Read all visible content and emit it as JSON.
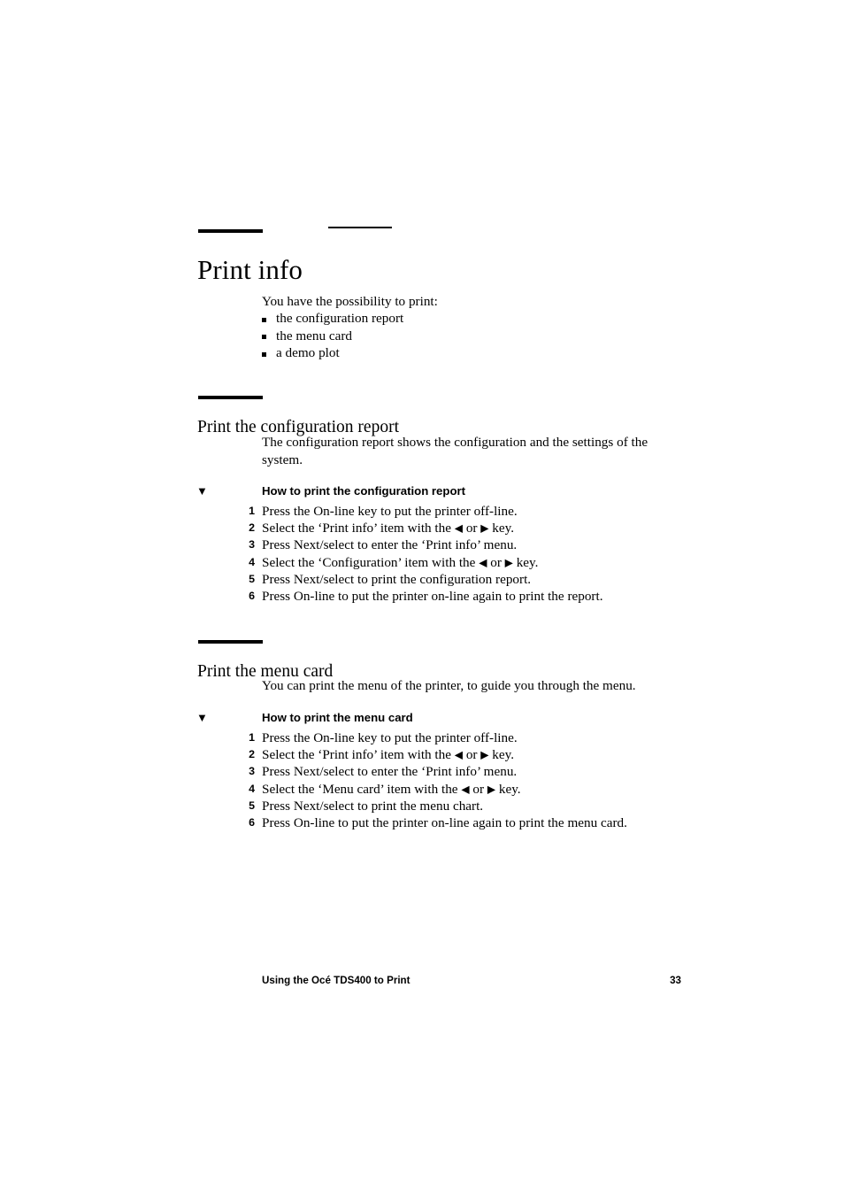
{
  "page": {
    "title": "Print info",
    "footer_text": "Using the Océ TDS400 to Print",
    "page_number": "33"
  },
  "intro": {
    "lead": "You have the possibility to print:",
    "bullets": [
      "the configuration report",
      "the menu card",
      "a demo plot"
    ]
  },
  "sections": [
    {
      "heading": "Print the configuration report",
      "body": "The configuration report shows the configuration and the settings of the system.",
      "procedure_marker": "▼",
      "procedure_title": "How to print the configuration report",
      "steps": [
        {
          "num": "1",
          "pre": "Press the On-line key to put the printer off-line.",
          "left_arrow": "",
          "mid": "",
          "right_arrow": "",
          "post": ""
        },
        {
          "num": "2",
          "pre": "Select the ‘Print info’ item with the ",
          "left_arrow": "◀",
          "mid": "  or  ",
          "right_arrow": "▶",
          "post": " key."
        },
        {
          "num": "3",
          "pre": "Press Next/select to enter the ‘Print info’ menu.",
          "left_arrow": "",
          "mid": "",
          "right_arrow": "",
          "post": ""
        },
        {
          "num": "4",
          "pre": "Select the ‘Configuration’ item with the ",
          "left_arrow": "◀",
          "mid": "  or  ",
          "right_arrow": "▶",
          "post": " key."
        },
        {
          "num": "5",
          "pre": "Press Next/select to print the configuration report.",
          "left_arrow": "",
          "mid": "",
          "right_arrow": "",
          "post": ""
        },
        {
          "num": "6",
          "pre": "Press On-line to put the printer on-line again to print the report.",
          "left_arrow": "",
          "mid": "",
          "right_arrow": "",
          "post": ""
        }
      ]
    },
    {
      "heading": "Print the menu card",
      "body": "You can print the menu of the printer, to guide you through the menu.",
      "procedure_marker": "▼",
      "procedure_title": "How to print the menu card",
      "steps": [
        {
          "num": "1",
          "pre": "Press the On-line key to put the printer off-line.",
          "left_arrow": "",
          "mid": "",
          "right_arrow": "",
          "post": ""
        },
        {
          "num": "2",
          "pre": "Select the ‘Print info’ item with the ",
          "left_arrow": "◀",
          "mid": "  or  ",
          "right_arrow": "▶",
          "post": " key."
        },
        {
          "num": "3",
          "pre": "Press Next/select to enter the ‘Print info’ menu.",
          "left_arrow": "",
          "mid": "",
          "right_arrow": "",
          "post": ""
        },
        {
          "num": "4",
          "pre": "Select the ‘Menu card’ item with the ",
          "left_arrow": "◀",
          "mid": "  or  ",
          "right_arrow": "▶",
          "post": " key."
        },
        {
          "num": "5",
          "pre": "Press Next/select to print the menu chart.",
          "left_arrow": "",
          "mid": "",
          "right_arrow": "",
          "post": ""
        },
        {
          "num": "6",
          "pre": "Press On-line to put the printer on-line again to print the menu card.",
          "left_arrow": "",
          "mid": "",
          "right_arrow": "",
          "post": ""
        }
      ]
    }
  ]
}
